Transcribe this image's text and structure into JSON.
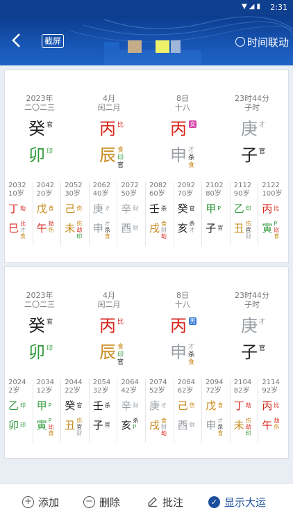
{
  "status": {
    "time": "2:31",
    "icons": "▼◢▮"
  },
  "header": {
    "screenshot_label": "截屏",
    "sync_label": "时间联动"
  },
  "colors": {
    "header_bg": "#1856b5",
    "accent": "#1b4e9b",
    "wood": "#2f9a3a",
    "fire": "#d9261c",
    "earth": "#c8891a",
    "metal": "#9aa0a6",
    "water": "#222222"
  },
  "chart1": {
    "pillars": [
      {
        "date1": "2023年",
        "date2": "二〇二三",
        "stem": "癸",
        "stem_tag": "官",
        "branch": "卯",
        "branch_tags": [
          "印"
        ]
      },
      {
        "date1": "4月",
        "date2": "闰二月",
        "stem": "丙",
        "stem_tag": "比",
        "branch": "辰",
        "branch_tags": [
          "食",
          "印",
          "官"
        ]
      },
      {
        "date1": "8日",
        "date2": "十八",
        "stem": "丙",
        "stem_tag": "女",
        "branch": "申",
        "branch_tags": [
          "才",
          "杀",
          "食"
        ]
      },
      {
        "date1": "23时44分",
        "date2": "子时",
        "stem": "庚",
        "stem_tag": "才",
        "branch": "子",
        "branch_tags": [
          "官"
        ]
      }
    ],
    "luck": [
      {
        "year": "2032",
        "age": "10岁",
        "s": "丁",
        "st": "劫",
        "b": "巳",
        "bt": [
          "比",
          "才",
          "食"
        ]
      },
      {
        "year": "2042",
        "age": "20岁",
        "s": "戊",
        "st": "食",
        "b": "午",
        "bt": [
          "劫",
          "伤"
        ]
      },
      {
        "year": "2052",
        "age": "30岁",
        "s": "己",
        "st": "伤",
        "b": "未",
        "bt": [
          "伤",
          "劫",
          "印"
        ]
      },
      {
        "year": "2062",
        "age": "40岁",
        "s": "庚",
        "st": "才",
        "b": "申",
        "bt": [
          "才",
          "杀",
          "食"
        ]
      },
      {
        "year": "2072",
        "age": "50岁",
        "s": "辛",
        "st": "财",
        "b": "酉",
        "bt": [
          "财"
        ]
      },
      {
        "year": "2082",
        "age": "60岁",
        "s": "壬",
        "st": "杀",
        "b": "戌",
        "bt": [
          "食",
          "财",
          "劫"
        ]
      },
      {
        "year": "2092",
        "age": "70岁",
        "s": "癸",
        "st": "官",
        "b": "亥",
        "bt": [
          "杀",
          "才"
        ]
      },
      {
        "year": "2102",
        "age": "80岁",
        "s": "甲",
        "st": "P",
        "b": "子",
        "bt": [
          "官"
        ]
      },
      {
        "year": "2112",
        "age": "90岁",
        "s": "乙",
        "st": "印",
        "b": "丑",
        "bt": [
          "伤",
          "官",
          "财"
        ]
      },
      {
        "year": "2122",
        "age": "100岁",
        "s": "丙",
        "st": "比",
        "b": "寅",
        "bt": [
          "P",
          "比",
          "食"
        ]
      }
    ]
  },
  "chart2": {
    "pillars": [
      {
        "date1": "2023年",
        "date2": "二〇二三",
        "stem": "癸",
        "stem_tag": "官",
        "branch": "卯",
        "branch_tags": [
          "印"
        ]
      },
      {
        "date1": "4月",
        "date2": "闰二月",
        "stem": "丙",
        "stem_tag": "比",
        "branch": "辰",
        "branch_tags": [
          "食",
          "印",
          "官"
        ]
      },
      {
        "date1": "8日",
        "date2": "十八",
        "stem": "丙",
        "stem_tag": "男",
        "branch": "申",
        "branch_tags": [
          "才",
          "杀",
          "食"
        ]
      },
      {
        "date1": "23时44分",
        "date2": "子时",
        "stem": "庚",
        "stem_tag": "才",
        "branch": "子",
        "branch_tags": [
          "官"
        ]
      }
    ],
    "luck": [
      {
        "year": "2024",
        "age": "2岁",
        "s": "乙",
        "st": "印",
        "b": "卯",
        "bt": [
          "印"
        ]
      },
      {
        "year": "2034",
        "age": "12岁",
        "s": "甲",
        "st": "P",
        "b": "寅",
        "bt": [
          "P",
          "比",
          "食"
        ]
      },
      {
        "year": "2044",
        "age": "22岁",
        "s": "癸",
        "st": "官",
        "b": "丑",
        "bt": [
          "伤",
          "官",
          "财"
        ]
      },
      {
        "year": "2054",
        "age": "32岁",
        "s": "壬",
        "st": "杀",
        "b": "子",
        "bt": [
          "官"
        ]
      },
      {
        "year": "2064",
        "age": "42岁",
        "s": "辛",
        "st": "财",
        "b": "亥",
        "bt": [
          "杀",
          "P"
        ]
      },
      {
        "year": "2074",
        "age": "52岁",
        "s": "庚",
        "st": "才",
        "b": "戌",
        "bt": [
          "食",
          "财",
          "劫"
        ]
      },
      {
        "year": "2084",
        "age": "62岁",
        "s": "己",
        "st": "伤",
        "b": "酉",
        "bt": [
          "财"
        ]
      },
      {
        "year": "2094",
        "age": "72岁",
        "s": "戊",
        "st": "食",
        "b": "申",
        "bt": [
          "才",
          "杀",
          "食"
        ]
      },
      {
        "year": "2104",
        "age": "82岁",
        "s": "丁",
        "st": "劫",
        "b": "未",
        "bt": [
          "伤",
          "劫",
          "印"
        ]
      },
      {
        "year": "2114",
        "age": "92岁",
        "s": "丙",
        "st": "比",
        "b": "午",
        "bt": [
          "劫",
          "伤"
        ]
      }
    ]
  },
  "bottom": {
    "add": "添加",
    "delete": "删除",
    "annotate": "批注",
    "show_luck": "显示大运"
  }
}
